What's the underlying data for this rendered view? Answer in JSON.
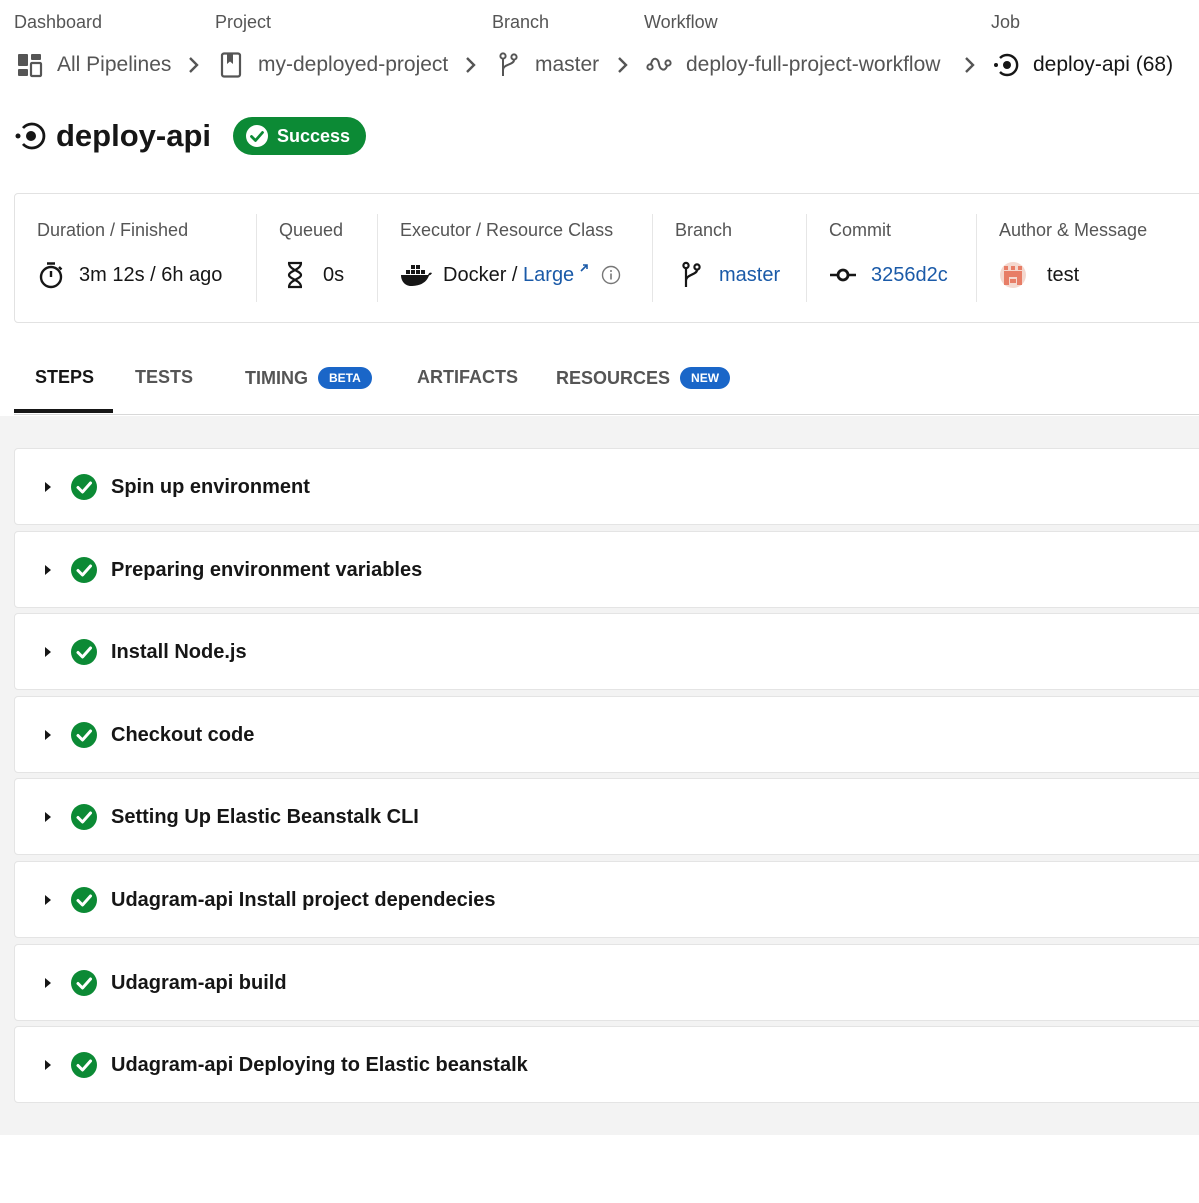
{
  "breadcrumb": {
    "dashboard": {
      "heading": "Dashboard",
      "label": "All Pipelines",
      "icon": "dashboard-grid-icon"
    },
    "project": {
      "heading": "Project",
      "label": "my-deployed-project",
      "icon": "bookmark-icon"
    },
    "branch": {
      "heading": "Branch",
      "label": "master",
      "icon": "branch-icon"
    },
    "workflow": {
      "heading": "Workflow",
      "label": "deploy-full-project-workflow",
      "icon": "workflow-icon"
    },
    "job": {
      "heading": "Job",
      "label": "deploy-api (68)",
      "icon": "job-icon"
    }
  },
  "header": {
    "title": "deploy-api",
    "status": "Success",
    "status_color": "#0c8a35"
  },
  "details": {
    "duration": {
      "label": "Duration / Finished",
      "value": "3m 12s / 6h ago",
      "icon": "stopwatch-icon"
    },
    "queued": {
      "label": "Queued",
      "value": "0s",
      "icon": "hourglass-icon"
    },
    "executor": {
      "label": "Executor / Resource Class",
      "executor": "Docker",
      "separator": " / ",
      "resource_class": "Large",
      "icon": "docker-icon"
    },
    "branch": {
      "label": "Branch",
      "value": "master",
      "icon": "branch-icon"
    },
    "commit": {
      "label": "Commit",
      "value": "3256d2c",
      "icon": "commit-icon"
    },
    "author": {
      "label": "Author & Message",
      "value": "test",
      "icon": "avatar"
    }
  },
  "tabs": [
    {
      "label": "STEPS",
      "active": true
    },
    {
      "label": "TESTS"
    },
    {
      "label": "TIMING",
      "pill": "BETA"
    },
    {
      "label": "ARTIFACTS"
    },
    {
      "label": "RESOURCES",
      "pill": "NEW"
    }
  ],
  "steps": [
    {
      "name": "Spin up environment",
      "status": "success"
    },
    {
      "name": "Preparing environment variables",
      "status": "success"
    },
    {
      "name": "Install Node.js",
      "status": "success"
    },
    {
      "name": "Checkout code",
      "status": "success"
    },
    {
      "name": "Setting Up Elastic Beanstalk CLI",
      "status": "success"
    },
    {
      "name": "Udagram-api Install project dependecies",
      "status": "success"
    },
    {
      "name": "Udagram-api build",
      "status": "success"
    },
    {
      "name": "Udagram-api Deploying to Elastic beanstalk",
      "status": "success"
    }
  ],
  "colors": {
    "success": "#0c8a35",
    "link": "#1a5aa8",
    "pill": "#1a66c8"
  }
}
